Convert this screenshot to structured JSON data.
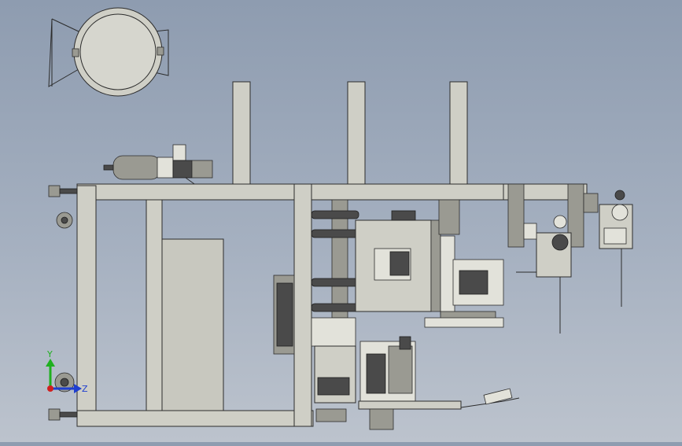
{
  "viewport": {
    "background_top": "#8e9cb0",
    "background_bottom": "#bcc3cd",
    "frame_color": "#cfcfc6"
  },
  "triad": {
    "y_label": "Y",
    "z_label": "Z",
    "y_color": "#1fb01f",
    "z_color": "#1f3fd0",
    "x_color": "#d01f1f"
  }
}
